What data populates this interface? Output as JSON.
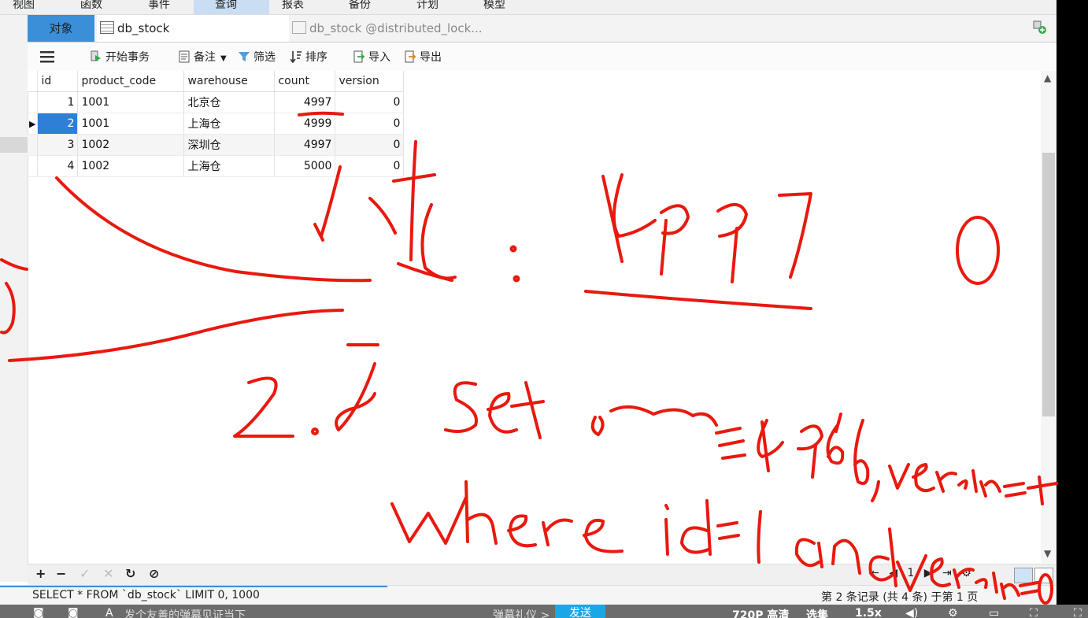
{
  "menu": [
    "视图",
    "函数",
    "事件",
    "查询",
    "报表",
    "备份",
    "计划",
    "模型"
  ],
  "menu_active": "查询",
  "tabs": {
    "objects": "对象",
    "tab1": "db_stock @distributed_lock...",
    "tab2": "db_stock @distributed_lock..."
  },
  "toolbar": {
    "begin_transaction": "开始事务",
    "note": "备注",
    "filter": "筛选",
    "sort": "排序",
    "import": "导入",
    "export": "导出"
  },
  "table": {
    "columns": [
      "id",
      "product_code",
      "warehouse",
      "count",
      "version"
    ],
    "rows": [
      {
        "id": "1",
        "product_code": "1001",
        "warehouse": "北京仓",
        "count": "4997",
        "version": "0"
      },
      {
        "id": "2",
        "product_code": "1001",
        "warehouse": "上海仓",
        "count": "4999",
        "version": "0"
      },
      {
        "id": "3",
        "product_code": "1002",
        "warehouse": "深圳仓",
        "count": "4997",
        "version": "0"
      },
      {
        "id": "4",
        "product_code": "1002",
        "warehouse": "上海仓",
        "count": "5000",
        "version": "0"
      }
    ]
  },
  "bottombar": {
    "add": "+",
    "remove": "−",
    "apply": "✓",
    "discard": "✕",
    "refresh": "↻",
    "stop": "⊘",
    "page_number": "1"
  },
  "status": {
    "sql": "SELECT * FROM `db_stock` LIMIT 0, 1000",
    "record": "第 2 条记录 (共 4 条) 于第 1 页"
  },
  "video": {
    "danmaku_placeholder": "发个友善的弹幕见证当下",
    "etiquette": "弹幕礼仪 >",
    "send": "发送",
    "quality": "720P 高清",
    "episodes": "选集",
    "speed": "1.5x"
  },
  "colors": {
    "accent": "#3b8fd9",
    "selection": "#2f7fd6",
    "annotation_ink": "#e8190e"
  }
}
